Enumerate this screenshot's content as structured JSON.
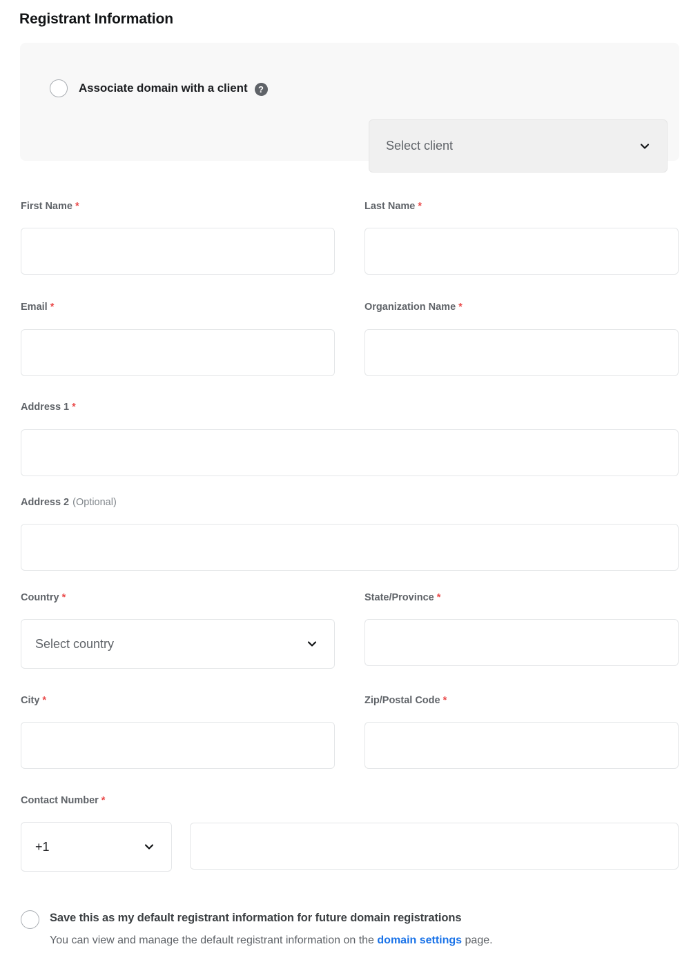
{
  "page": {
    "title": "Registrant Information"
  },
  "client_card": {
    "radio_label": "Associate domain with a client",
    "help_icon": "help-icon",
    "help_glyph": "?",
    "client_select": {
      "value": "Select client",
      "chevron": "chevron-down-icon",
      "disabled": true
    }
  },
  "fields": {
    "first_name": {
      "label": "First Name",
      "required_mark": "*",
      "value": "",
      "placeholder": ""
    },
    "last_name": {
      "label": "Last Name",
      "required_mark": "*",
      "value": "",
      "placeholder": ""
    },
    "email": {
      "label": "Email",
      "required_mark": "*",
      "value": "",
      "placeholder": ""
    },
    "organization_name": {
      "label": "Organization Name",
      "required_mark": "*",
      "value": "",
      "placeholder": ""
    },
    "address1": {
      "label": "Address 1",
      "required_mark": "*",
      "value": "",
      "placeholder": ""
    },
    "address2": {
      "label": "Address 2",
      "optional_mark": "(Optional)",
      "value": "",
      "placeholder": ""
    },
    "country": {
      "label": "Country",
      "required_mark": "*",
      "value": "Select country",
      "chevron": "chevron-down-icon"
    },
    "state_province": {
      "label": "State/Province",
      "required_mark": "*",
      "value": "",
      "placeholder": ""
    },
    "city": {
      "label": "City",
      "required_mark": "*",
      "value": "",
      "placeholder": ""
    },
    "zip_postal_code": {
      "label": "Zip/Postal Code",
      "required_mark": "*",
      "value": "",
      "placeholder": ""
    },
    "contact_number": {
      "label": "Contact Number",
      "required_mark": "*",
      "country_code": "+1",
      "chevron": "chevron-down-icon",
      "value": "",
      "placeholder": ""
    }
  },
  "save_default": {
    "title": "Save this as my default registrant information for future domain registrations",
    "sub_prefix": "You can view and manage the default registrant information on the ",
    "link_text": "domain settings",
    "sub_suffix": " page."
  },
  "colors": {
    "accent_link": "#1a73e8",
    "required": "#ea4a4a",
    "card_bg": "#f8f8f8",
    "disabled_bg": "#f0f0f0",
    "border": "#e4e6e8",
    "label": "#5f6368"
  }
}
